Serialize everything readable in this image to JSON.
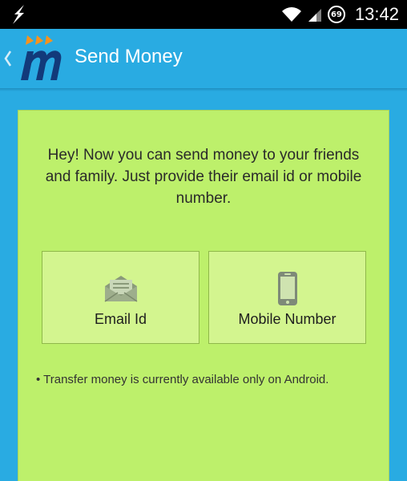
{
  "status_bar": {
    "left_icon": "usb-debug-icon",
    "battery_level": "69",
    "time": "13:42"
  },
  "app_bar": {
    "title": "Send Money",
    "back_icon": "chevron-left-icon",
    "logo": "mobikwik-logo"
  },
  "card": {
    "intro_text": "Hey! Now you can send money to your friends and family. Just provide their email id or mobile number.",
    "options": [
      {
        "label": "Email Id",
        "icon": "envelope-icon"
      },
      {
        "label": "Mobile Number",
        "icon": "phone-icon"
      }
    ],
    "note": "• Transfer money is currently available only on Android."
  },
  "colors": {
    "app_bar": "#29abe2",
    "card": "#bdf06b",
    "option": "#d3f58f",
    "status_bar": "#000000"
  }
}
